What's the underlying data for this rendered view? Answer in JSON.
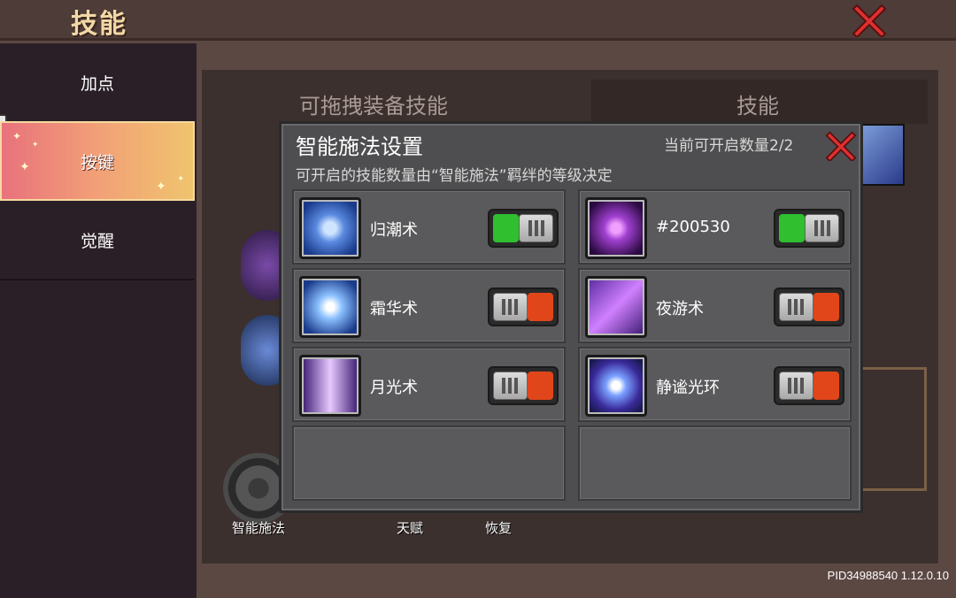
{
  "header": {
    "title": "技能"
  },
  "sidebar": {
    "items": [
      {
        "label": "加点",
        "active": false
      },
      {
        "label": "按键",
        "active": true
      },
      {
        "label": "觉醒",
        "active": false
      }
    ]
  },
  "background": {
    "left_label": "可拖拽装备技能",
    "right_label": "技能",
    "bottom_labels": [
      "智能施法",
      "天赋",
      "恢复"
    ],
    "version": "PID34988540 1.12.0.10"
  },
  "modal": {
    "title": "智能施法设置",
    "count_text": "当前可开启数量2/2",
    "subtitle": "可开启的技能数量由“智能施法”羁绊的等级决定",
    "skills": [
      {
        "name": "归潮术",
        "enabled": true,
        "icon": "tide-swirl-icon",
        "color": "#3a6fd0"
      },
      {
        "name": "#200530",
        "enabled": true,
        "icon": "dark-void-icon",
        "color": "#6a2a9a"
      },
      {
        "name": "霜华术",
        "enabled": false,
        "icon": "frost-crystal-icon",
        "color": "#4a8ad8"
      },
      {
        "name": "夜游术",
        "enabled": false,
        "icon": "night-shadow-icon",
        "color": "#8a3ac8"
      },
      {
        "name": "月光术",
        "enabled": false,
        "icon": "moonlight-beam-icon",
        "color": "#9a4ad8"
      },
      {
        "name": "静谧光环",
        "enabled": false,
        "icon": "serene-aura-icon",
        "color": "#4a4ac8"
      }
    ]
  },
  "colors": {
    "toggle_on": "#2fbf2f",
    "toggle_off": "#e0461a",
    "close_red": "#e03030"
  }
}
